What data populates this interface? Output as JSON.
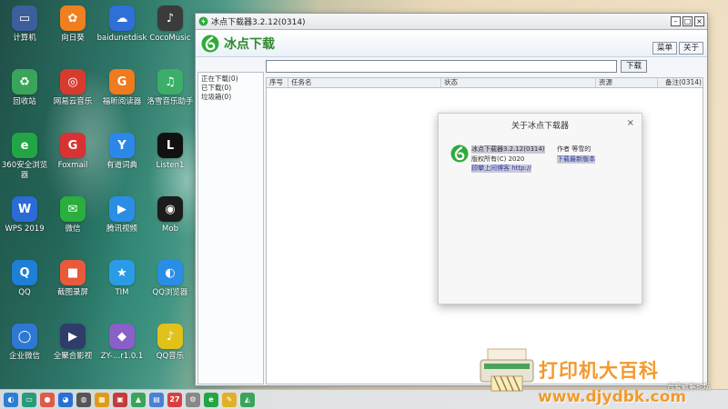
{
  "desktop": {
    "icons": [
      {
        "label": "计算机",
        "glyph": "▭",
        "color": "#3c5f9c"
      },
      {
        "label": "向日葵",
        "glyph": "✿",
        "color": "#f07f1f"
      },
      {
        "label": "baidunetdisk",
        "glyph": "☁",
        "color": "#2f6fd8"
      },
      {
        "label": "CocoMusic",
        "glyph": "♪",
        "color": "#3b3b3b"
      },
      {
        "label": "回收站",
        "glyph": "♻",
        "color": "#3aa55a"
      },
      {
        "label": "网易云音乐",
        "glyph": "◎",
        "color": "#d83b2e"
      },
      {
        "label": "福昕阅读器",
        "glyph": "G",
        "color": "#f07a1e"
      },
      {
        "label": "洛雪音乐助手",
        "glyph": "♫",
        "color": "#3cae6a"
      },
      {
        "label": "360安全浏览器",
        "glyph": "e",
        "color": "#22a645"
      },
      {
        "label": "Foxmail",
        "glyph": "G",
        "color": "#d83232"
      },
      {
        "label": "有道词典",
        "glyph": "Y",
        "color": "#2b88e8"
      },
      {
        "label": "Listen1",
        "glyph": "L",
        "color": "#111111"
      },
      {
        "label": "WPS 2019",
        "glyph": "W",
        "color": "#2a6bd6"
      },
      {
        "label": "微信",
        "glyph": "✉",
        "color": "#2aae3c"
      },
      {
        "label": "腾讯视频",
        "glyph": "▶",
        "color": "#2a8de6"
      },
      {
        "label": "Mob",
        "glyph": "◉",
        "color": "#1c1c1c"
      },
      {
        "label": "QQ",
        "glyph": "Q",
        "color": "#1e7fd6"
      },
      {
        "label": "截图录屏",
        "glyph": "■",
        "color": "#e85a3a"
      },
      {
        "label": "TIM",
        "glyph": "★",
        "color": "#2a9be6"
      },
      {
        "label": "QQ浏览器",
        "glyph": "◐",
        "color": "#2a8de6"
      },
      {
        "label": "企业微信",
        "glyph": "◯",
        "color": "#2d78d2"
      },
      {
        "label": "全聚合影视",
        "glyph": "▶",
        "color": "#2f3d6a"
      },
      {
        "label": "ZY-…r1.0.1",
        "glyph": "◆",
        "color": "#8a5fc8"
      },
      {
        "label": "QQ音乐",
        "glyph": "♪",
        "color": "#e0c21a"
      }
    ]
  },
  "taskbar": {
    "items": [
      {
        "glyph": "◐",
        "color": "#2b7fd6"
      },
      {
        "glyph": "▭",
        "color": "#2a9a78"
      },
      {
        "glyph": "●",
        "color": "#e05a4a"
      },
      {
        "glyph": "◕",
        "color": "#2a6fd6"
      },
      {
        "glyph": "◍",
        "color": "#555555"
      },
      {
        "glyph": "▦",
        "color": "#e09a1a"
      },
      {
        "glyph": "▣",
        "color": "#c23c3c"
      },
      {
        "glyph": "▲",
        "color": "#3aa55a"
      },
      {
        "glyph": "▤",
        "color": "#4a7fd6"
      },
      {
        "glyph": "27",
        "color": "#d84040"
      },
      {
        "glyph": "⚙",
        "color": "#888888"
      },
      {
        "glyph": "e",
        "color": "#22a645"
      },
      {
        "glyph": "✎",
        "color": "#e0b02a"
      },
      {
        "glyph": "◭",
        "color": "#3aa55a"
      }
    ]
  },
  "app": {
    "window_title": "冰点下载器3.2.12(0314)",
    "brand_name": "冰点下载",
    "menu_buttons": [
      "菜单",
      "关于"
    ],
    "url_input_value": "",
    "download_button": "下载",
    "sidebar_items": [
      "正在下载(0)",
      "已下载(0)",
      "垃圾箱(0)"
    ],
    "table_headers": [
      "序号",
      "任务名",
      "状态",
      "资源",
      "备注(0314)"
    ]
  },
  "about_dialog": {
    "title": "关于冰点下载器",
    "close": "×",
    "version": "冰点下载器3.2.12(0314)",
    "author": "作者 等雪的",
    "copyright": "版权所有(C) 2020",
    "download_latest": "下载最新版本",
    "blog": "顾攀上间博客 http://"
  },
  "watermark": {
    "title": "打印机大百科",
    "subtitle": "吾爱破解论坛",
    "url": "www.djydbk.com"
  },
  "colors": {
    "brand_green": "#2f8a2f",
    "watermark_orange": "#f29a2e"
  }
}
